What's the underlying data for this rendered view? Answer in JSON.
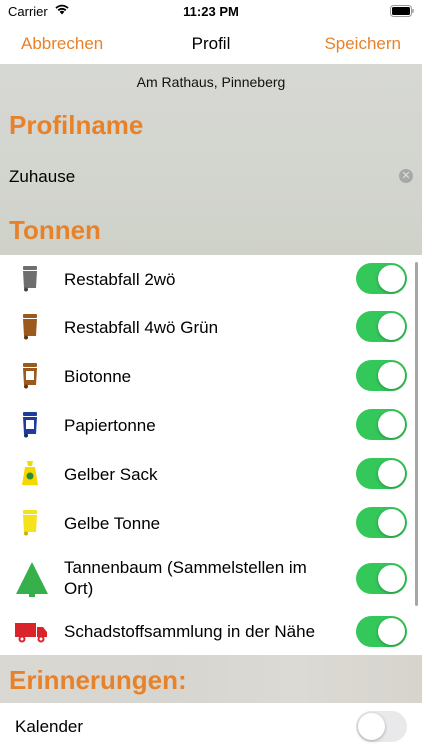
{
  "status_bar": {
    "carrier": "Carrier",
    "time": "11:23 PM"
  },
  "nav": {
    "cancel_label": "Abbrechen",
    "title": "Profil",
    "save_label": "Speichern"
  },
  "location": "Am Rathaus, Pinneberg",
  "profile_section": {
    "title": "Profilname",
    "value": "Zuhause",
    "clear_icon": "clear-circle-icon"
  },
  "bins_section": {
    "title": "Tonnen",
    "items": [
      {
        "label": "Restabfall 2wö",
        "icon": "grey-bin-icon",
        "color": "#6e6e6e",
        "enabled": true
      },
      {
        "label": "Restabfall 4wö Grün",
        "icon": "brown-bin-icon",
        "color": "#9a5a1e",
        "enabled": true
      },
      {
        "label": "Biotonne",
        "icon": "bio-bin-icon",
        "color": "#9a5a1e",
        "badge": "B",
        "enabled": true
      },
      {
        "label": "Papiertonne",
        "icon": "paper-bin-icon",
        "color": "#1f3c9c",
        "badge": "P",
        "enabled": true
      },
      {
        "label": "Gelber Sack",
        "icon": "yellow-bag-icon",
        "color": "#f5d800",
        "enabled": true
      },
      {
        "label": "Gelbe Tonne",
        "icon": "yellow-bin-icon",
        "color": "#f5e21a",
        "enabled": true
      },
      {
        "label": "Tannenbaum (Sammelstellen im Ort)",
        "icon": "tree-icon",
        "color": "#35b04a",
        "enabled": true
      },
      {
        "label": "Schadstoffsammlung in der Nähe",
        "icon": "truck-icon",
        "color": "#d9252a",
        "enabled": true
      }
    ]
  },
  "reminders_section": {
    "title": "Erinnerungen:",
    "items": [
      {
        "label": "Kalender",
        "enabled": false
      }
    ]
  },
  "colors": {
    "accent": "#e8822a",
    "toggle_on": "#34c759",
    "toggle_off": "#e9e9eb"
  }
}
